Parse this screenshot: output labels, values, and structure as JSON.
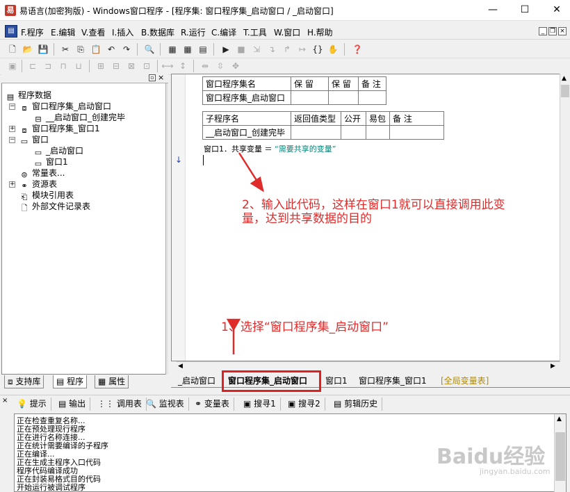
{
  "window": {
    "title": "易语言(加密狗版) - Windows窗口程序 - [程序集: 窗口程序集_启动窗口 / _启动窗口]",
    "minimize": "—",
    "maximize": "☐",
    "close": "✕"
  },
  "menu": {
    "items": [
      "F.程序",
      "E.编辑",
      "V.查看",
      "I.插入",
      "B.数据库",
      "R.运行",
      "C.编译",
      "T.工具",
      "W.窗口",
      "H.帮助"
    ]
  },
  "tree": {
    "items": [
      {
        "label": "程序数据"
      },
      {
        "label": "窗口程序集_启动窗口"
      },
      {
        "label": "__启动窗口_创建完毕"
      },
      {
        "label": "窗口程序集_窗口1"
      },
      {
        "label": "窗口"
      },
      {
        "label": "_启动窗口"
      },
      {
        "label": "窗口1"
      },
      {
        "label": "常量表..."
      },
      {
        "label": "资源表"
      },
      {
        "label": "模块引用表"
      },
      {
        "label": "外部文件记录表"
      }
    ]
  },
  "left_tabs": [
    "支持库",
    "程序",
    "属性"
  ],
  "assembly_table": {
    "headers": [
      "窗口程序集名",
      "保 留",
      "保 留",
      "备 注"
    ],
    "row": [
      "窗口程序集_启动窗口",
      "",
      "",
      ""
    ]
  },
  "sub_table": {
    "headers": [
      "子程序名",
      "返回值类型",
      "公开",
      "易包",
      "备 注"
    ],
    "row": [
      "__启动窗口_创建完毕",
      "",
      "",
      "",
      ""
    ]
  },
  "code": {
    "line1_prefix": "窗口1．共享变量 ＝ ",
    "line1_string": "“需要共享的变量”"
  },
  "annotations": {
    "step2_line1": "2、输入此代码，这样在窗口1就可以直接调用此变",
    "step2_line2": "量，达到共享数据的目的",
    "step1": "1、选择“窗口程序集_启动窗口”"
  },
  "editor_tabs": [
    "_启动窗口",
    "窗口程序集_启动窗口",
    "窗口1",
    "窗口程序集_窗口1",
    "[全局变量表]"
  ],
  "output_tabs": [
    "提示",
    "输出",
    "调用表",
    "监视表",
    "变量表",
    "搜寻1",
    "搜寻2",
    "剪辑历史"
  ],
  "output_lines": [
    "正在检查重复名称...",
    "正在预处理现行程序",
    "正在进行名称连接...",
    "正在统计需要编译的子程序",
    "正在编译...",
    "正在生成主程序入口代码",
    "程序代码编译成功",
    "正在封装易格式目的代码",
    "开始运行被调试程序"
  ],
  "watermark": {
    "brand": "Baidu经验",
    "url": "jingyan.baidu.com"
  },
  "colors": {
    "annotation": "#e02b2b",
    "string_literal": "#00857a",
    "highlight_box": "#e02020"
  }
}
